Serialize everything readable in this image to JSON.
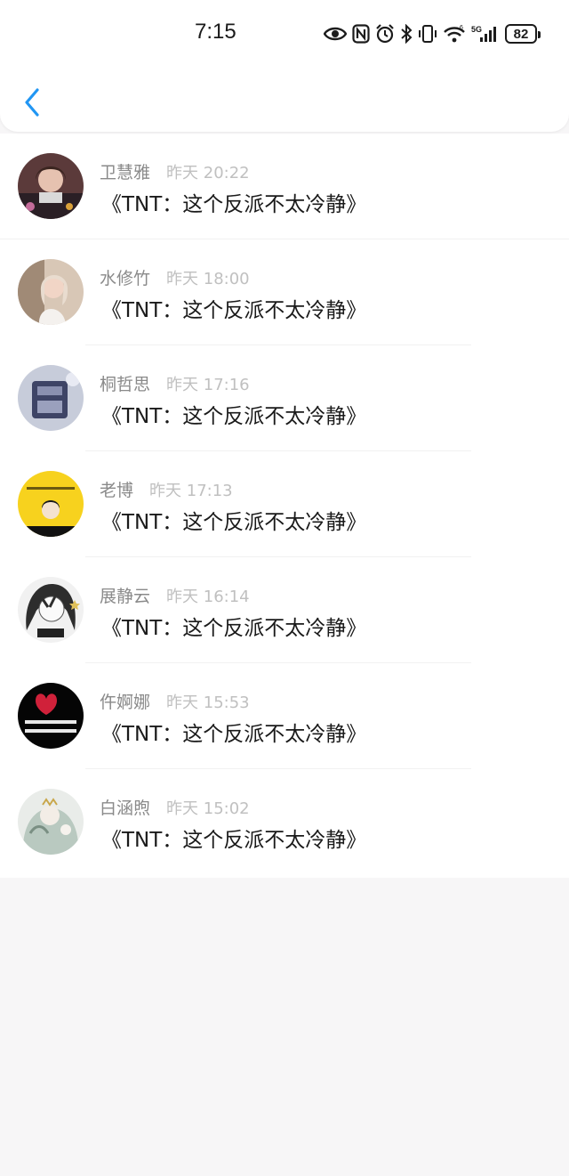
{
  "status_bar": {
    "time": "7:15",
    "icons": [
      "eye-icon",
      "nfc-icon",
      "alarm-icon",
      "bluetooth-icon",
      "vibrate-icon",
      "wifi-icon",
      "signal-5g-icon"
    ],
    "signal_label": "5G",
    "battery": "82"
  },
  "header": {
    "back_icon": "chevron-left-icon",
    "accent_color": "#2196f3"
  },
  "list": {
    "items": [
      {
        "name": "卫慧雅",
        "time": "昨天 20:22",
        "message": "《TNT：这个反派不太冷静》"
      },
      {
        "name": "水修竹",
        "time": "昨天 18:00",
        "message": "《TNT：这个反派不太冷静》"
      },
      {
        "name": "桐哲思",
        "time": "昨天 17:16",
        "message": "《TNT：这个反派不太冷静》"
      },
      {
        "name": "老博",
        "time": "昨天 17:13",
        "message": "《TNT：这个反派不太冷静》"
      },
      {
        "name": "展静云",
        "time": "昨天 16:14",
        "message": "《TNT：这个反派不太冷静》"
      },
      {
        "name": "仵婀娜",
        "time": "昨天 15:53",
        "message": "《TNT：这个反派不太冷静》"
      },
      {
        "name": "白涵煦",
        "time": "昨天 15:02",
        "message": "《TNT：这个反派不太冷静》"
      }
    ]
  },
  "colors": {
    "page_background": "#f7f6f7",
    "name_text": "#8a8a8a",
    "time_text": "#c0c0c0",
    "message_text": "#1a1a1a"
  }
}
